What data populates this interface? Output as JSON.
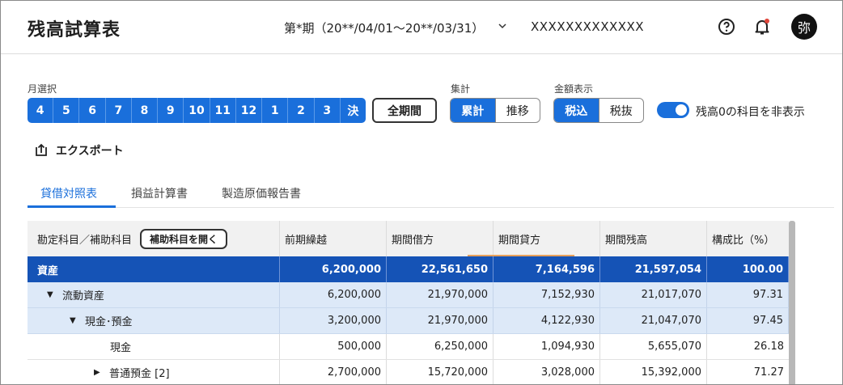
{
  "header": {
    "title": "残高試算表",
    "period": "第*期（20**/04/01〜20**/03/31）",
    "company": "XXXXXXXXXXXXX",
    "avatar": "弥",
    "icons": [
      "help-circle-icon",
      "bell-icon"
    ]
  },
  "controls": {
    "month_label": "月選択",
    "months": [
      "4",
      "5",
      "6",
      "7",
      "8",
      "9",
      "10",
      "11",
      "12",
      "1",
      "2",
      "3",
      "決"
    ],
    "all_period": "全期間",
    "agg_label": "集計",
    "agg_options": [
      "累計",
      "推移"
    ],
    "agg_selected": "累計",
    "amount_label": "金額表示",
    "amount_options": [
      "税込",
      "税抜"
    ],
    "amount_selected": "税込",
    "hide_zero_label": "残高0の科目を非表示",
    "hide_zero_on": true,
    "export_label": "エクスポート"
  },
  "tabs": [
    "貸借対照表",
    "損益計算書",
    "製造原価報告書"
  ],
  "active_tab": "貸借対照表",
  "table": {
    "account_header": "勘定科目／補助科目",
    "open_sub_button": "補助科目を開く",
    "columns": [
      "前期繰越",
      "期間借方",
      "期間貸方",
      "期間残高",
      "構成比（%）"
    ],
    "rows": [
      {
        "name": "資産",
        "marker": "",
        "values": [
          "6,200,000",
          "22,561,650",
          "7,164,596",
          "21,597,054",
          "100.00"
        ]
      },
      {
        "name": "流動資産",
        "marker": "▼",
        "values": [
          "6,200,000",
          "21,970,000",
          "7,152,930",
          "21,017,070",
          "97.31"
        ]
      },
      {
        "name": "現金･預金",
        "marker": "▼",
        "values": [
          "3,200,000",
          "21,970,000",
          "4,122,930",
          "21,047,070",
          "97.45"
        ]
      },
      {
        "name": "現金",
        "marker": "",
        "values": [
          "500,000",
          "6,250,000",
          "1,094,930",
          "5,655,070",
          "26.18"
        ]
      },
      {
        "name": "普通預金 [2]",
        "marker": "▶",
        "values": [
          "2,700,000",
          "15,720,000",
          "3,028,000",
          "15,392,000",
          "71.27"
        ]
      }
    ]
  }
}
